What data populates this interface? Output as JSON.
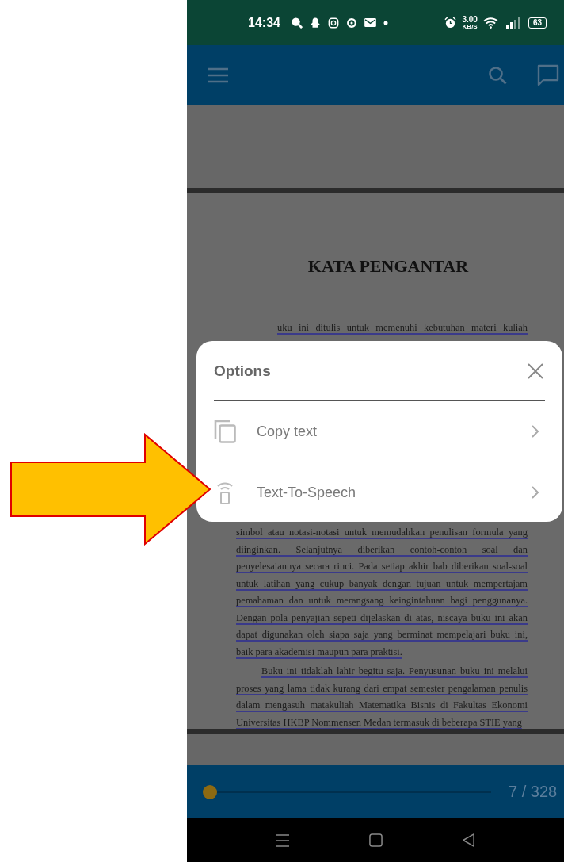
{
  "status_bar": {
    "time": "14:34",
    "net_speed": "3.00",
    "net_unit": "KB/S",
    "battery": "63"
  },
  "document": {
    "title": "KATA PENGANTAR",
    "first_line": "uku ini ditulis untuk memenuhi kebutuhan materi kuliah",
    "paragraphs": [
      {
        "indent": false,
        "lines": [
          "simbol atau notasi-notasi untuk memudahkan penulisan formula yang",
          "diinginkan. Selanjutnya diberikan contoh-contoh soal dan",
          "penyelesaiannya secara rinci. Pada setiap akhir bab diberikan soal-soal",
          "untuk latihan yang cukup banyak dengan tujuan untuk mempertajam",
          "pemahaman dan untuk merangsang keingintahuan bagi penggunanya.",
          "Dengan pola penyajian sepeti dijelaskan di atas, niscaya buku ini akan",
          "dapat digunakan oleh siapa saja yang berminat mempelajari buku ini,",
          "baik para akademisi maupun para praktisi."
        ]
      },
      {
        "indent": true,
        "lines": [
          "Buku ini tidaklah lahir begitu saja. Penyusunan buku ini melalui",
          "proses yang lama tidak kurang dari empat semester pengalaman penulis",
          "dalam mengasuh matakuliah Matematika Bisnis di Fakultas Ekonomi",
          "Universitas HKBP Nommensen Medan termasuk di beberapa STIE yang"
        ]
      }
    ]
  },
  "dialog": {
    "title": "Options",
    "items": [
      {
        "kind": "copy",
        "label": "Copy text"
      },
      {
        "kind": "speech",
        "label": "Text-To-Speech"
      }
    ]
  },
  "pager": {
    "level": 0.0,
    "reading": "7 / 328"
  }
}
